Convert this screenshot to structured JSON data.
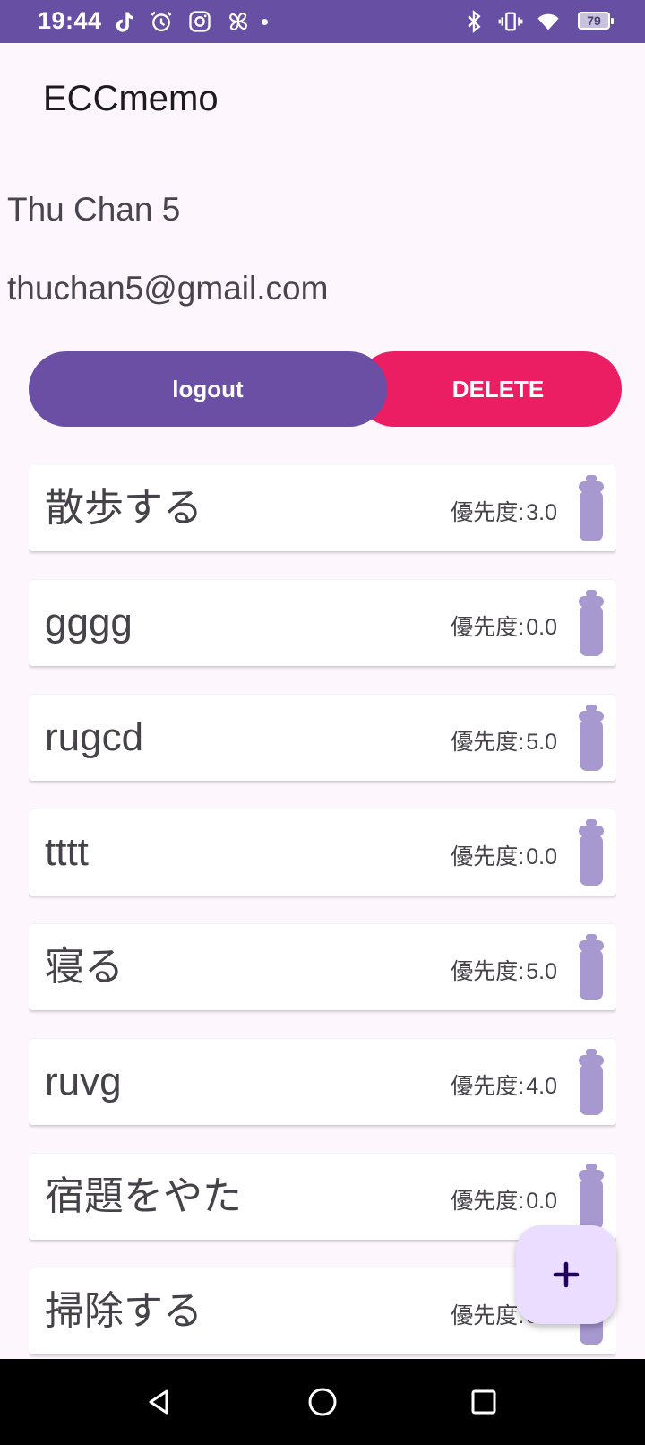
{
  "status_bar": {
    "time": "19:44",
    "battery": "79",
    "icons": [
      "tiktok-icon",
      "alarm-icon",
      "instagram-icon",
      "pinwheel-icon",
      "bluetooth-icon",
      "vibrate-icon",
      "wifi-icon",
      "battery-icon"
    ]
  },
  "app": {
    "title": "ECCmemo"
  },
  "user": {
    "name": "Thu Chan 5",
    "email": "thuchan5@gmail.com"
  },
  "buttons": {
    "logout": "logout",
    "delete": "DELETE"
  },
  "memos": [
    {
      "title": "散歩する",
      "priority_label": "優先度:",
      "priority": "3.0"
    },
    {
      "title": "gggg",
      "priority_label": "優先度:",
      "priority": "0.0"
    },
    {
      "title": "rugcd",
      "priority_label": "優先度:",
      "priority": "5.0"
    },
    {
      "title": "tttt",
      "priority_label": "優先度:",
      "priority": "0.0"
    },
    {
      "title": "寝る",
      "priority_label": "優先度:",
      "priority": "5.0"
    },
    {
      "title": "ruvg",
      "priority_label": "優先度:",
      "priority": "4.0"
    },
    {
      "title": "宿題をやた",
      "priority_label": "優先度:",
      "priority": "0.0"
    },
    {
      "title": "掃除する",
      "priority_label": "優先度:",
      "priority": "3.0"
    }
  ],
  "fab": {
    "icon": "plus-icon"
  },
  "nav": {
    "icons": [
      "back-icon",
      "home-icon",
      "recents-icon"
    ]
  },
  "colors": {
    "status_bar": "#6750a4",
    "logout": "#6a4fa5",
    "delete": "#ec1e63",
    "trash": "#a898d0",
    "fab": "#eaddff"
  }
}
